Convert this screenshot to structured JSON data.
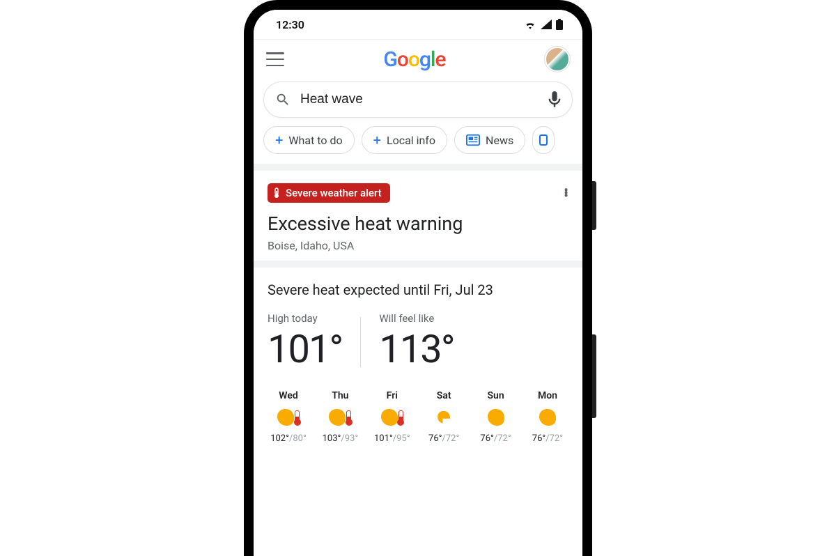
{
  "status": {
    "time": "12:30"
  },
  "header": {
    "logo_text": "Google"
  },
  "search": {
    "query": "Heat wave"
  },
  "chips": [
    {
      "label": "What to do",
      "icon": "plus"
    },
    {
      "label": "Local info",
      "icon": "plus"
    },
    {
      "label": "News",
      "icon": "news"
    }
  ],
  "alert": {
    "pill_label": "Severe weather alert",
    "title": "Excessive heat warning",
    "location": "Boise, Idaho, USA"
  },
  "forecast": {
    "heading": "Severe heat expected until Fri, Jul 23",
    "high_label": "High today",
    "high_value": "101°",
    "feel_label": "Will feel like",
    "feel_value": "113°",
    "days": [
      {
        "name": "Wed",
        "hi": "102°",
        "lo": "/80°",
        "icon": "hot"
      },
      {
        "name": "Thu",
        "hi": "103°",
        "lo": "/93°",
        "icon": "hot"
      },
      {
        "name": "Fri",
        "hi": "101°",
        "lo": "/95°",
        "icon": "hot"
      },
      {
        "name": "Sat",
        "hi": "76°",
        "lo": "/72°",
        "icon": "partly"
      },
      {
        "name": "Sun",
        "hi": "76°",
        "lo": "/72°",
        "icon": "sun"
      },
      {
        "name": "Mon",
        "hi": "76°",
        "lo": "/72°",
        "icon": "sun"
      }
    ]
  }
}
